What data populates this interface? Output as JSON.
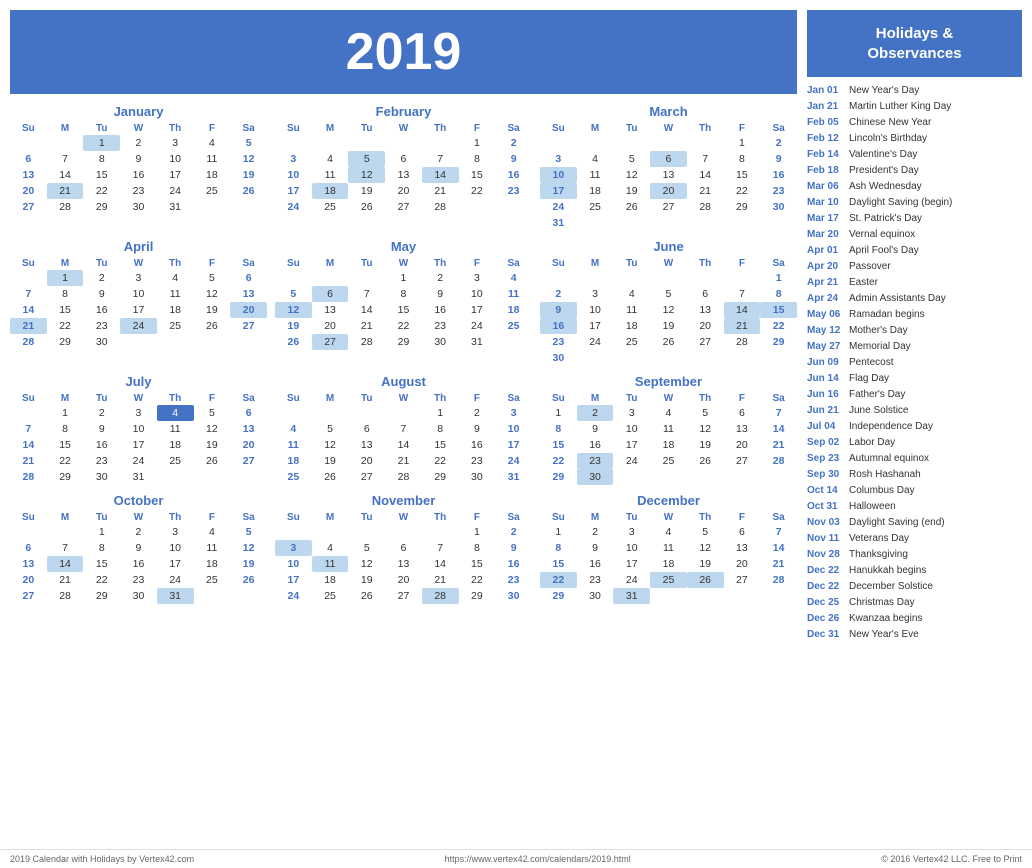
{
  "year": "2019",
  "sidebar": {
    "title": "Holidays &\nObservances",
    "holidays": [
      {
        "date": "Jan 01",
        "name": "New Year's Day"
      },
      {
        "date": "Jan 21",
        "name": "Martin Luther King Day"
      },
      {
        "date": "Feb 05",
        "name": "Chinese New Year"
      },
      {
        "date": "Feb 12",
        "name": "Lincoln's Birthday"
      },
      {
        "date": "Feb 14",
        "name": "Valentine's Day"
      },
      {
        "date": "Feb 18",
        "name": "President's Day"
      },
      {
        "date": "Mar 06",
        "name": "Ash Wednesday"
      },
      {
        "date": "Mar 10",
        "name": "Daylight Saving (begin)"
      },
      {
        "date": "Mar 17",
        "name": "St. Patrick's Day"
      },
      {
        "date": "Mar 20",
        "name": "Vernal equinox"
      },
      {
        "date": "Apr 01",
        "name": "April Fool's Day"
      },
      {
        "date": "Apr 20",
        "name": "Passover"
      },
      {
        "date": "Apr 21",
        "name": "Easter"
      },
      {
        "date": "Apr 24",
        "name": "Admin Assistants Day"
      },
      {
        "date": "May 06",
        "name": "Ramadan begins"
      },
      {
        "date": "May 12",
        "name": "Mother's Day"
      },
      {
        "date": "May 27",
        "name": "Memorial Day"
      },
      {
        "date": "Jun 09",
        "name": "Pentecost"
      },
      {
        "date": "Jun 14",
        "name": "Flag Day"
      },
      {
        "date": "Jun 16",
        "name": "Father's Day"
      },
      {
        "date": "Jun 21",
        "name": "June Solstice"
      },
      {
        "date": "Jul 04",
        "name": "Independence Day"
      },
      {
        "date": "Sep 02",
        "name": "Labor Day"
      },
      {
        "date": "Sep 23",
        "name": "Autumnal equinox"
      },
      {
        "date": "Sep 30",
        "name": "Rosh Hashanah"
      },
      {
        "date": "Oct 14",
        "name": "Columbus Day"
      },
      {
        "date": "Oct 31",
        "name": "Halloween"
      },
      {
        "date": "Nov 03",
        "name": "Daylight Saving (end)"
      },
      {
        "date": "Nov 11",
        "name": "Veterans Day"
      },
      {
        "date": "Nov 28",
        "name": "Thanksgiving"
      },
      {
        "date": "Dec 22",
        "name": "Hanukkah begins"
      },
      {
        "date": "Dec 22",
        "name": "December Solstice"
      },
      {
        "date": "Dec 25",
        "name": "Christmas Day"
      },
      {
        "date": "Dec 26",
        "name": "Kwanzaa begins"
      },
      {
        "date": "Dec 31",
        "name": "New Year's Eve"
      }
    ]
  },
  "footer": {
    "left": "2019 Calendar with Holidays by Vertex42.com",
    "center": "https://www.vertex42.com/calendars/2019.html",
    "right": "© 2016 Vertex42 LLC. Free to Print"
  }
}
